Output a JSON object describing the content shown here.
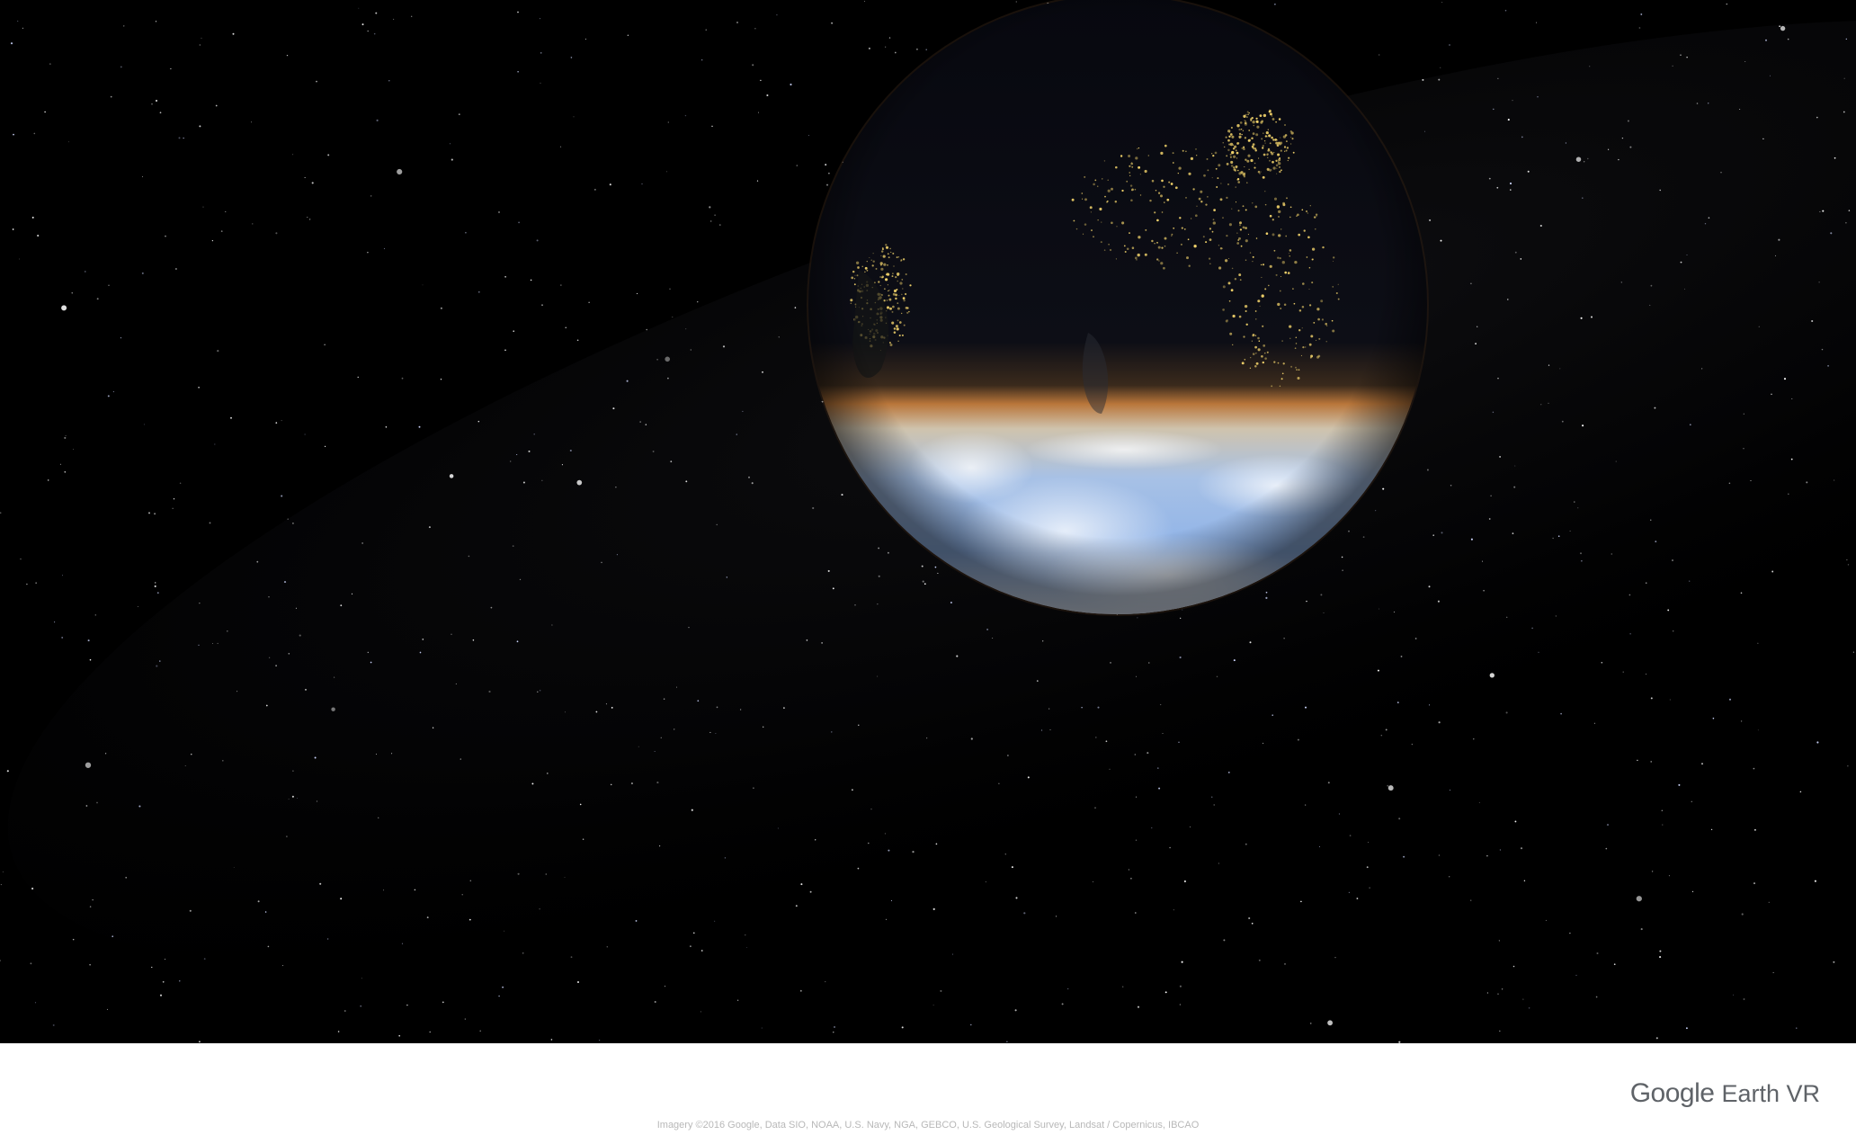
{
  "viewport": {
    "scene": "earth-from-space"
  },
  "brand": {
    "company": "Google",
    "product": "Earth VR"
  },
  "attribution": {
    "text": "Imagery ©2016 Google, Data SIO, NOAA, U.S. Navy, NGA, GEBCO, U.S. Geological Survey, Landsat / Copernicus, IBCAO"
  },
  "colors": {
    "space": "#000000",
    "footer": "#ffffff",
    "logo_text": "#5f6368",
    "attribution_text": "#b8b8b8",
    "ocean_day": "#8fb3e8",
    "night_side": "#07080f",
    "city_lights": "#f2d36b",
    "terminator_glow": "#b9763a"
  },
  "icons": {
    "globe": "earth-globe-icon"
  }
}
